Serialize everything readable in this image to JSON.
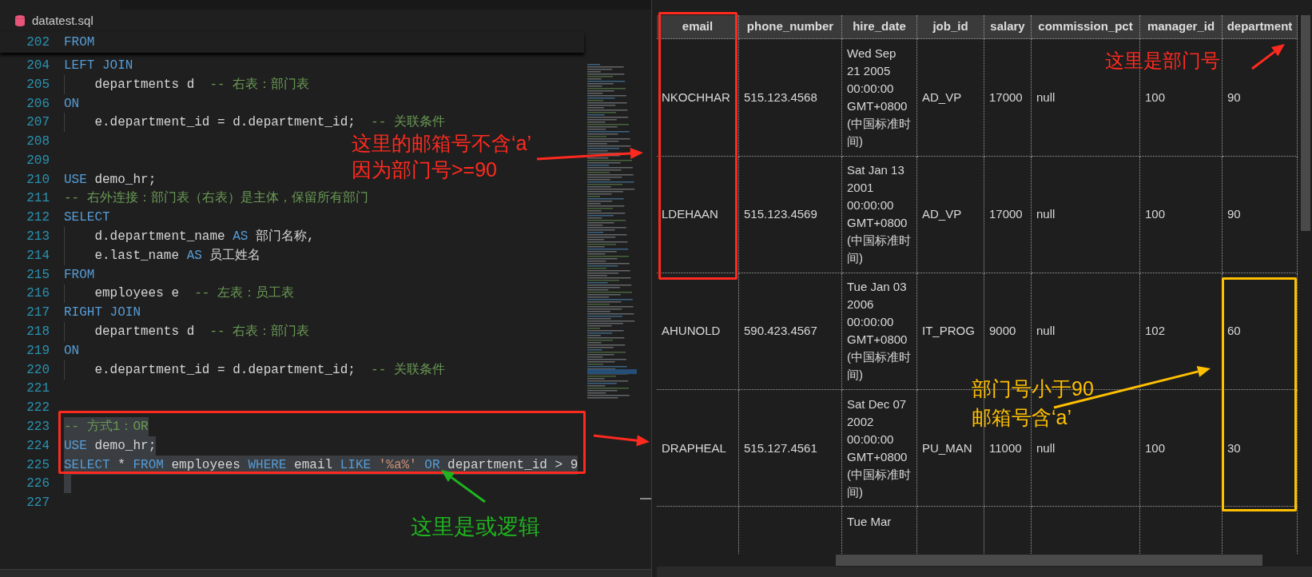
{
  "editor": {
    "file_tab": "datatest.sql",
    "sticky_line": {
      "number": "202",
      "tokens": [
        {
          "kind": "keyword",
          "text": "FROM"
        }
      ]
    },
    "lines": [
      {
        "number": "204",
        "guide": false,
        "selected": false,
        "tokens": [
          {
            "kind": "keyword",
            "text": "LEFT JOIN"
          }
        ]
      },
      {
        "number": "205",
        "guide": true,
        "selected": false,
        "tokens": [
          {
            "kind": "text",
            "text": "    departments d  "
          },
          {
            "kind": "comment",
            "text": "-- 右表：部门表"
          }
        ]
      },
      {
        "number": "206",
        "guide": false,
        "selected": false,
        "tokens": [
          {
            "kind": "keyword",
            "text": "ON"
          }
        ]
      },
      {
        "number": "207",
        "guide": true,
        "selected": false,
        "tokens": [
          {
            "kind": "text",
            "text": "    e.department_id = d.department_id;  "
          },
          {
            "kind": "comment",
            "text": "-- 关联条件"
          }
        ]
      },
      {
        "number": "208",
        "guide": false,
        "selected": false
      },
      {
        "number": "209",
        "guide": false,
        "selected": false
      },
      {
        "number": "210",
        "guide": false,
        "selected": false,
        "tokens": [
          {
            "kind": "keyword",
            "text": "USE"
          },
          {
            "kind": "text",
            "text": " demo_hr;"
          }
        ]
      },
      {
        "number": "211",
        "guide": false,
        "selected": false,
        "tokens": [
          {
            "kind": "comment",
            "text": "-- 右外连接：部门表（右表）是主体，保留所有部门"
          }
        ]
      },
      {
        "number": "212",
        "guide": false,
        "selected": false,
        "tokens": [
          {
            "kind": "keyword",
            "text": "SELECT"
          }
        ]
      },
      {
        "number": "213",
        "guide": true,
        "selected": false,
        "tokens": [
          {
            "kind": "text",
            "text": "    d.department_name "
          },
          {
            "kind": "keyword",
            "text": "AS"
          },
          {
            "kind": "text",
            "text": " 部门名称,"
          }
        ]
      },
      {
        "number": "214",
        "guide": true,
        "selected": false,
        "tokens": [
          {
            "kind": "text",
            "text": "    e.last_name "
          },
          {
            "kind": "keyword",
            "text": "AS"
          },
          {
            "kind": "text",
            "text": " 员工姓名"
          }
        ]
      },
      {
        "number": "215",
        "guide": false,
        "selected": false,
        "tokens": [
          {
            "kind": "keyword",
            "text": "FROM"
          }
        ]
      },
      {
        "number": "216",
        "guide": true,
        "selected": false,
        "tokens": [
          {
            "kind": "text",
            "text": "    employees e  "
          },
          {
            "kind": "comment",
            "text": "-- 左表：员工表"
          }
        ]
      },
      {
        "number": "217",
        "guide": false,
        "selected": false,
        "tokens": [
          {
            "kind": "keyword",
            "text": "RIGHT JOIN"
          }
        ]
      },
      {
        "number": "218",
        "guide": true,
        "selected": false,
        "tokens": [
          {
            "kind": "text",
            "text": "    departments d  "
          },
          {
            "kind": "comment",
            "text": "-- 右表：部门表"
          }
        ]
      },
      {
        "number": "219",
        "guide": false,
        "selected": false,
        "tokens": [
          {
            "kind": "keyword",
            "text": "ON"
          }
        ]
      },
      {
        "number": "220",
        "guide": true,
        "selected": false,
        "tokens": [
          {
            "kind": "text",
            "text": "    e.department_id = d.department_id;  "
          },
          {
            "kind": "comment",
            "text": "-- 关联条件"
          }
        ]
      },
      {
        "number": "221",
        "guide": false,
        "selected": false
      },
      {
        "number": "222",
        "guide": false,
        "selected": false
      },
      {
        "number": "223",
        "guide": false,
        "selected": true,
        "tokens": [
          {
            "kind": "comment",
            "text": "-- 方式1：OR"
          }
        ]
      },
      {
        "number": "224",
        "guide": false,
        "selected": true,
        "tokens": [
          {
            "kind": "keyword",
            "text": "USE"
          },
          {
            "kind": "text",
            "text": " demo_hr;"
          }
        ]
      },
      {
        "number": "225",
        "guide": false,
        "selected": true,
        "tokens": [
          {
            "kind": "keyword",
            "text": "SELECT"
          },
          {
            "kind": "text",
            "text": " * "
          },
          {
            "kind": "keyword",
            "text": "FROM"
          },
          {
            "kind": "text",
            "text": " employees "
          },
          {
            "kind": "keyword",
            "text": "WHERE"
          },
          {
            "kind": "text",
            "text": " email "
          },
          {
            "kind": "keyword",
            "text": "LIKE"
          },
          {
            "kind": "string",
            "text": " '%a%'"
          },
          {
            "kind": "keyword",
            "text": " OR"
          },
          {
            "kind": "text",
            "text": " department_id > 9"
          }
        ]
      },
      {
        "number": "226",
        "guide": false,
        "selected": true
      },
      {
        "number": "227",
        "guide": false,
        "selected": false
      }
    ]
  },
  "results": {
    "columns": [
      "email",
      "phone_number",
      "hire_date",
      "job_id",
      "salary",
      "commission_pct",
      "manager_id",
      "department"
    ],
    "rows": [
      [
        "NKOCHHAR",
        "515.123.4568",
        "Wed Sep 21 2005 00:00:00 GMT+0800 (中国标准时间)",
        "AD_VP",
        "17000",
        "null",
        "100",
        "90"
      ],
      [
        "LDEHAAN",
        "515.123.4569",
        "Sat Jan 13 2001 00:00:00 GMT+0800 (中国标准时间)",
        "AD_VP",
        "17000",
        "null",
        "100",
        "90"
      ],
      [
        "AHUNOLD",
        "590.423.4567",
        "Tue Jan 03 2006 00:00:00 GMT+0800 (中国标准时间)",
        "IT_PROG",
        "9000",
        "null",
        "102",
        "60"
      ],
      [
        "DRAPHEAL",
        "515.127.4561",
        "Sat Dec 07 2002 00:00:00 GMT+0800 (中国标准时间)",
        "PU_MAN",
        "11000",
        "null",
        "100",
        "30"
      ]
    ],
    "partial_row": {
      "hire_date": "Tue Mar"
    }
  },
  "annotations": {
    "boxes": [
      {
        "color": "#ff2a1f"
      },
      {
        "color": "#ff2a1f"
      },
      {
        "color": "#ffc000"
      }
    ],
    "callouts": [
      {
        "color": "#ff2a1f",
        "lines": [
          "这里的邮箱号不含‘a’",
          "因为部门号>=90"
        ]
      },
      {
        "color": "#ff2a1f",
        "lines": [
          "这里是部门号"
        ]
      },
      {
        "color": "#1fb51f",
        "lines": [
          "这里是或逻辑"
        ]
      },
      {
        "color": "#ffc000",
        "lines": [
          "部门号小于90",
          "邮箱号含‘a’"
        ]
      }
    ]
  }
}
